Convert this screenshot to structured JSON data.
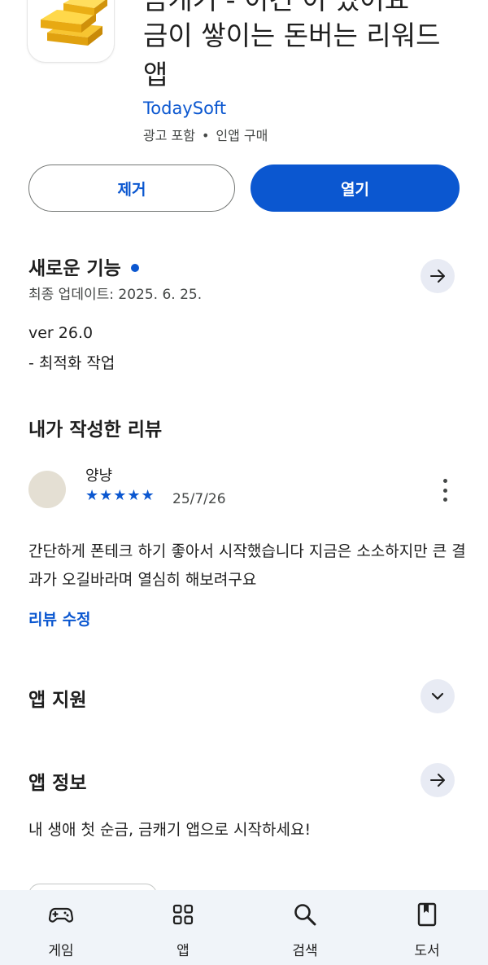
{
  "app": {
    "title_line1": "금캐기 - 이건 이 있어요",
    "title_line2": "금이 쌓이는 돈버는 리워드",
    "title_line3": "앱",
    "developer": "TodaySoft",
    "meta_ads": "광고 포함",
    "meta_dot": "•",
    "meta_iap": "인앱 구매",
    "icon": "gold-bars-icon"
  },
  "actions": {
    "remove_label": "제거",
    "open_label": "열기"
  },
  "whats_new": {
    "title": "새로운 기능",
    "last_updated": "최종 업데이트: 2025. 6. 25.",
    "version": "ver 26.0",
    "note": "- 최적화 작업"
  },
  "my_review": {
    "title": "내가 작성한 리뷰",
    "reviewer": "양냥",
    "rating": 5,
    "stars": "★★★★★",
    "date": "25/7/26",
    "text": "간단하게 폰테크 하기 좋아서 시작했습니다 지금은 소소하지만 큰 결과가 오길바라며 열심히 해보려구요",
    "edit_label": "리뷰 수정"
  },
  "app_support": {
    "title": "앱 지원"
  },
  "app_info": {
    "title": "앱 정보",
    "description": "내 생애 첫 순금, 금캐기 앱으로 시작하세요!"
  },
  "bottom_nav": {
    "items": [
      {
        "label": "게임",
        "icon": "gamepad-icon"
      },
      {
        "label": "앱",
        "icon": "apps-grid-icon"
      },
      {
        "label": "검색",
        "icon": "search-icon"
      },
      {
        "label": "도서",
        "icon": "book-icon"
      }
    ]
  },
  "colors": {
    "accent": "#0b57d0",
    "nav_bg": "#f0f4f9",
    "circle_btn_bg": "#e8ebf4"
  }
}
